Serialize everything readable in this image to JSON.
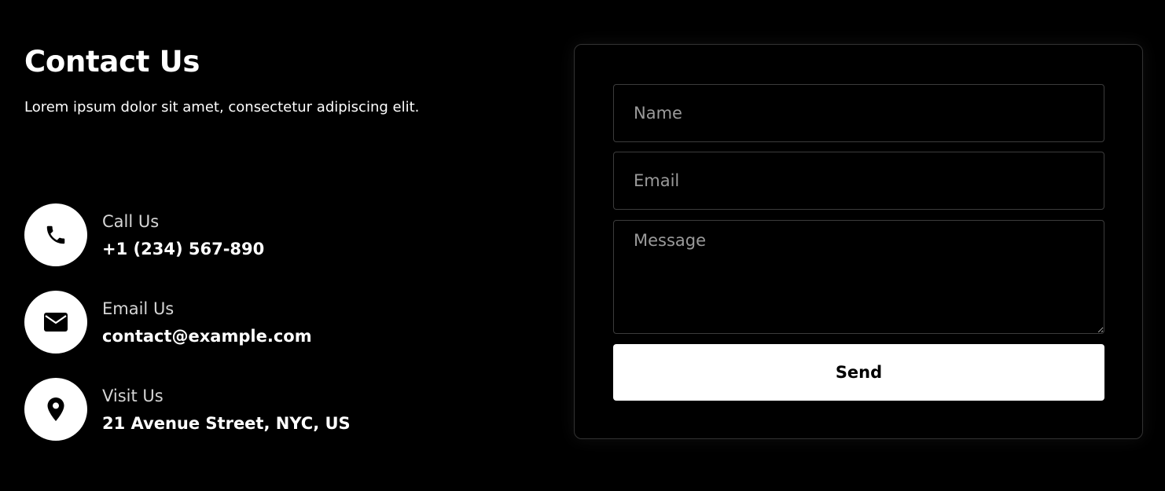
{
  "contact": {
    "title": "Contact Us",
    "subtitle": "Lorem ipsum dolor sit amet, consectetur adipiscing elit."
  },
  "info": [
    {
      "icon": "phone-icon",
      "label": "Call Us",
      "value": "+1 (234) 567-890"
    },
    {
      "icon": "envelope-icon",
      "label": "Email Us",
      "value": "contact@example.com"
    },
    {
      "icon": "location-pin-icon",
      "label": "Visit Us",
      "value": "21 Avenue Street, NYC, US"
    }
  ],
  "form": {
    "name_placeholder": "Name",
    "email_placeholder": "Email",
    "message_placeholder": "Message",
    "name_value": "",
    "email_value": "",
    "message_value": "",
    "send_label": "Send"
  },
  "colors": {
    "background": "#000000",
    "text": "#ffffff",
    "muted_text": "#d6d6d6",
    "border": "#3c3c3c",
    "button_bg": "#ffffff",
    "button_text": "#000000"
  }
}
